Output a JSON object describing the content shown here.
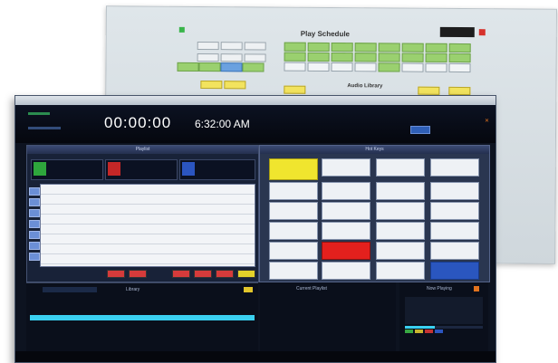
{
  "schedule_window": {
    "title": "Play Schedule",
    "audio_library_label": "Audio Library",
    "colors": {
      "green": "#9ad06f",
      "blue": "#6aa1e0",
      "yellow": "#f2e35e",
      "red": "#d6322c"
    }
  },
  "main_window": {
    "clock": "00:00:00",
    "time": "6:32:00 AM",
    "panels": {
      "left_title": "Playlist",
      "right_title": "Hot Keys",
      "library_title": "Library",
      "current_title": "Current Playlist",
      "right_bottom_title": "Now Playing"
    },
    "hotkey_colors": {
      "yellow": "#f0e52e",
      "red": "#e3201d",
      "blue": "#2a56bf"
    },
    "now_playing_progress": 0.38
  }
}
